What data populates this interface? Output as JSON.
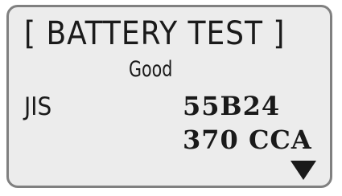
{
  "screen": {
    "title": "[ BATTERY TEST ]",
    "result": "Good",
    "standard": "JIS",
    "battery_model": "55B24",
    "rating": "370 CCA",
    "next_icon": "down-triangle-icon"
  }
}
